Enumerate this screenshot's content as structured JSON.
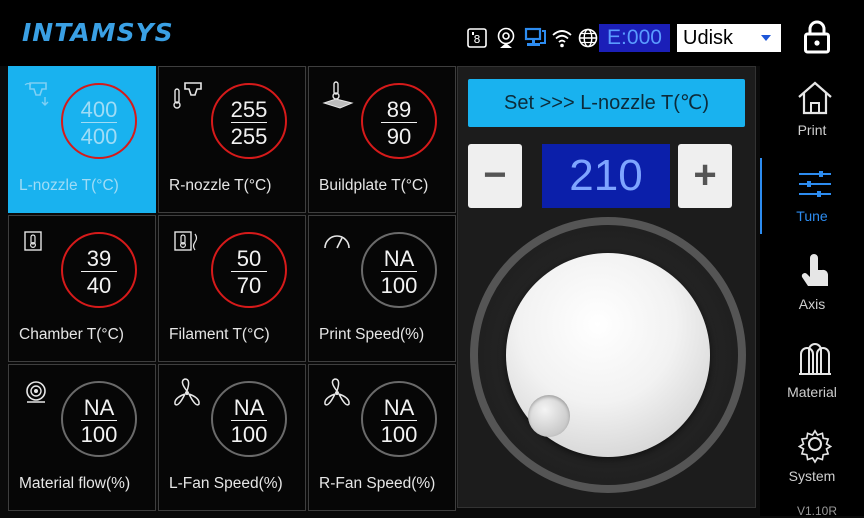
{
  "app": {
    "brand": "INTAMSYS"
  },
  "topbar": {
    "status_icons": [
      "sd-card-icon",
      "webcam-icon",
      "network-lan-icon",
      "wifi-icon",
      "globe-icon"
    ],
    "error_badge": "E:000",
    "storage_select": "Udisk",
    "lock_icon": "lock-icon"
  },
  "tiles": [
    {
      "label": "L-nozzle T(°C)",
      "current": "400",
      "target": "400",
      "icon": "nozzle-icon",
      "state": "selected",
      "ring": "red"
    },
    {
      "label": "R-nozzle T(°C)",
      "current": "255",
      "target": "255",
      "icon": "nozzle-icon",
      "state": "normal",
      "ring": "red"
    },
    {
      "label": "Buildplate T(°C)",
      "current": "89",
      "target": "90",
      "icon": "buildplate-icon",
      "state": "normal",
      "ring": "red"
    },
    {
      "label": "Chamber T(°C)",
      "current": "39",
      "target": "40",
      "icon": "chamber-icon",
      "state": "normal",
      "ring": "red"
    },
    {
      "label": "Filament T(°C)",
      "current": "50",
      "target": "70",
      "icon": "filament-temp-icon",
      "state": "normal",
      "ring": "red"
    },
    {
      "label": "Print Speed(%)",
      "current": "NA",
      "target": "100",
      "icon": "speed-gauge-icon",
      "state": "normal",
      "ring": "gray"
    },
    {
      "label": "Material flow(%)",
      "current": "NA",
      "target": "100",
      "icon": "spool-icon",
      "state": "normal",
      "ring": "gray"
    },
    {
      "label": "L-Fan Speed(%)",
      "current": "NA",
      "target": "100",
      "icon": "fan-icon",
      "state": "normal",
      "ring": "gray"
    },
    {
      "label": "R-Fan Speed(%)",
      "current": "NA",
      "target": "100",
      "icon": "fan-icon",
      "state": "normal",
      "ring": "gray"
    }
  ],
  "panel": {
    "set_button": "Set >>> L-nozzle T(℃)",
    "minus_label": "−",
    "plus_label": "+",
    "value": "210"
  },
  "nav": {
    "items": [
      {
        "label": "Print",
        "icon": "home-icon"
      },
      {
        "label": "Tune",
        "icon": "sliders-icon",
        "active": true
      },
      {
        "label": "Axis",
        "icon": "hand-pointer-icon"
      },
      {
        "label": "Material",
        "icon": "spools-icon"
      },
      {
        "label": "System",
        "icon": "gear-icon"
      }
    ],
    "version": "V1.10R"
  },
  "colors": {
    "accent": "#19b2ef",
    "hot_ring": "#d61a1a",
    "value_bg": "#0b1faa",
    "nav_active": "#2d8cf0"
  }
}
